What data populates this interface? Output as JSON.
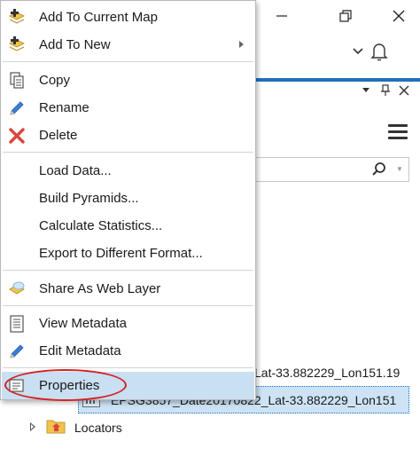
{
  "context_menu": {
    "items": [
      {
        "label": "Add To Current Map",
        "icon": "add-layer-icon"
      },
      {
        "label": "Add To New",
        "icon": "add-layer-icon",
        "has_submenu": true
      },
      {
        "label": "Copy",
        "icon": "copy-icon"
      },
      {
        "label": "Rename",
        "icon": "pencil-icon"
      },
      {
        "label": "Delete",
        "icon": "delete-x-icon"
      },
      {
        "label": "Load Data..."
      },
      {
        "label": "Build Pyramids..."
      },
      {
        "label": "Calculate Statistics..."
      },
      {
        "label": "Export to Different Format..."
      },
      {
        "label": "Share As Web Layer",
        "icon": "share-web-layer-icon"
      },
      {
        "label": "View Metadata",
        "icon": "view-metadata-icon"
      },
      {
        "label": "Edit Metadata",
        "icon": "edit-metadata-icon"
      },
      {
        "label": "Properties",
        "icon": "properties-icon",
        "highlighted": true
      }
    ]
  },
  "catalog_pane": {
    "tree": [
      {
        "label": "Lat-33.882229_Lon151.19"
      },
      {
        "label": "EPSG3857_Date20170822_Lat-33.882229_Lon151",
        "selected": true
      },
      {
        "label": "Locators"
      }
    ]
  },
  "colors": {
    "accent": "#1f6fbf",
    "selection": "#c9dff2",
    "annotation": "#d32323"
  }
}
